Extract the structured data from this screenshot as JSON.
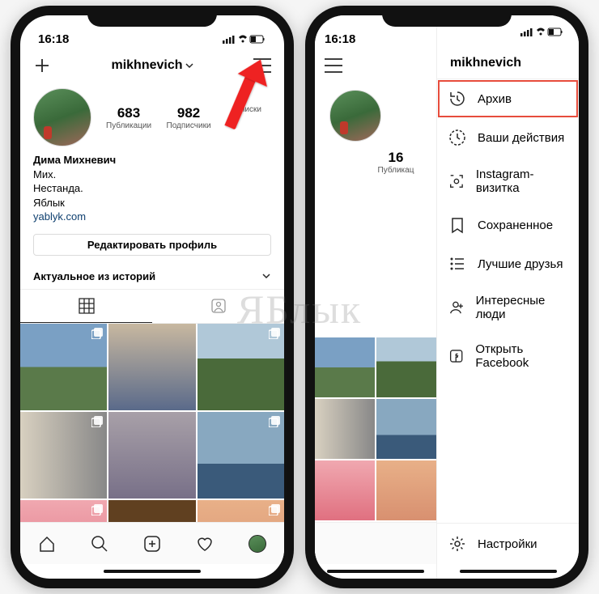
{
  "status": {
    "time": "16:18"
  },
  "profile": {
    "username": "mikhnevich",
    "stats": {
      "posts": {
        "num": "683",
        "label": "Публикации"
      },
      "followers": {
        "num": "982",
        "label": "Подписчики"
      },
      "following": {
        "num": "",
        "label": "дписки"
      }
    },
    "name": "Дима Михневич",
    "bio_line1": "Мих.",
    "bio_line2": "Нестанда.",
    "bio_line3": "Яблык",
    "link": "yablyk.com",
    "edit_button": "Редактировать профиль",
    "highlights_label": "Актуальное из историй"
  },
  "underlay": {
    "posts_count": "16",
    "posts_label": "Публикац"
  },
  "drawer": {
    "username": "mikhnevich",
    "items": [
      {
        "label": "Архив",
        "icon": "history-icon"
      },
      {
        "label": "Ваши действия",
        "icon": "activity-icon"
      },
      {
        "label": "Instagram-визитка",
        "icon": "nametag-icon"
      },
      {
        "label": "Сохраненное",
        "icon": "bookmark-icon"
      },
      {
        "label": "Лучшие друзья",
        "icon": "list-icon"
      },
      {
        "label": "Интересные люди",
        "icon": "discover-people-icon"
      },
      {
        "label": "Открыть Facebook",
        "icon": "facebook-icon"
      }
    ],
    "settings": "Настройки"
  },
  "watermark": "ЯБлык"
}
